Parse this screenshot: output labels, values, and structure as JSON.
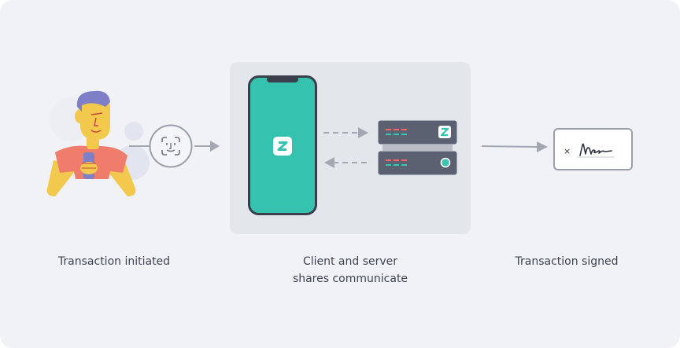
{
  "steps": [
    {
      "label": "Transaction initiated"
    },
    {
      "label_line1": "Client and server",
      "label_line2": "shares communicate"
    },
    {
      "label": "Transaction signed"
    }
  ],
  "signature": {
    "mark": "×"
  },
  "colors": {
    "background": "#f0f2f5",
    "panel": "#e3e6eb",
    "phone_screen": "#35c3b0",
    "server": "#5b6170",
    "arrow": "#a3a8b2",
    "led_red": "#ee6b63",
    "led_teal": "#3cc5b4",
    "shirt": "#f07c6b",
    "skin": "#f2c94c",
    "hair": "#7f7fc8"
  },
  "icons": [
    "person-illustration",
    "face-id-icon",
    "phone-icon",
    "app-logo-icon",
    "server-icon",
    "signature-card-icon"
  ]
}
